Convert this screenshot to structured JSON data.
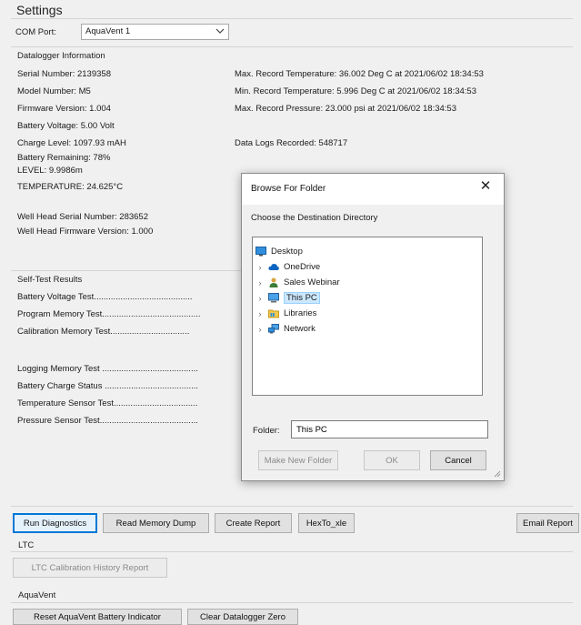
{
  "settings": {
    "title": "Settings",
    "com_port_label": "COM Port:",
    "com_port_value": "AquaVent 1"
  },
  "datalogger": {
    "section_label": "Datalogger Information",
    "left": [
      "Serial Number: 2139358",
      "Model Number: M5",
      "Firmware Version: 1.004",
      "Battery Voltage: 5.00 Volt",
      "Charge Level: 1097.93 mAH",
      "Battery Remaining: 78%",
      "LEVEL: 9.9986m",
      "TEMPERATURE: 24.625°C"
    ],
    "well_head": [
      "Well Head Serial Number: 283652",
      "Well Head Firmware Version: 1.000"
    ],
    "right": [
      "Max. Record Temperature: 36.002 Deg C at 2021/06/02 18:34:53",
      "Min. Record Temperature: 5.996 Deg C at 2021/06/02 18:34:53",
      "Max. Record Pressure: 23.000 psi at 2021/06/02 18:34:53"
    ],
    "logs_recorded": "Data Logs Recorded: 548717"
  },
  "self_test": {
    "section_label": "Self-Test Results",
    "tests": [
      "Battery Voltage Test.........................................",
      "Program Memory Test.........................................",
      "Calibration Memory Test.................................",
      "Logging Memory Test ........................................",
      "Battery Charge Status .......................................",
      "Temperature Sensor Test...................................",
      "Pressure Sensor Test........................................."
    ]
  },
  "buttons": {
    "run_diagnostics": "Run Diagnostics",
    "read_memory_dump": "Read Memory Dump",
    "create_report": "Create Report",
    "hexto_xle": "HexTo_xle",
    "email_report": "Email Report"
  },
  "ltc": {
    "section_label": "LTC",
    "calibration_history": "LTC Calibration History Report"
  },
  "aquavent": {
    "section_label": "AquaVent",
    "reset_battery": "Reset AquaVent Battery Indicator",
    "clear_zero": "Clear Datalogger Zero"
  },
  "dialog": {
    "title": "Browse For Folder",
    "close_glyph": "✕",
    "prompt": "Choose the Destination Directory",
    "tree": [
      {
        "label": "Desktop",
        "icon": "desktop-icon",
        "expander": "",
        "level": 0,
        "selected": false
      },
      {
        "label": "OneDrive",
        "icon": "cloud-icon",
        "expander": "›",
        "level": 1,
        "selected": false
      },
      {
        "label": "Sales Webinar",
        "icon": "user-icon",
        "expander": "›",
        "level": 1,
        "selected": false
      },
      {
        "label": "This PC",
        "icon": "computer-icon",
        "expander": "›",
        "level": 1,
        "selected": true
      },
      {
        "label": "Libraries",
        "icon": "library-folder-icon",
        "expander": "›",
        "level": 1,
        "selected": false
      },
      {
        "label": "Network",
        "icon": "network-icon",
        "expander": "›",
        "level": 1,
        "selected": false
      }
    ],
    "folder_label": "Folder:",
    "folder_value": "This PC",
    "make_new_folder": "Make New Folder",
    "ok": "OK",
    "cancel": "Cancel"
  },
  "colors": {
    "background": "#f0f0f0",
    "accent": "#0078d7",
    "selection": "#cce8ff"
  }
}
